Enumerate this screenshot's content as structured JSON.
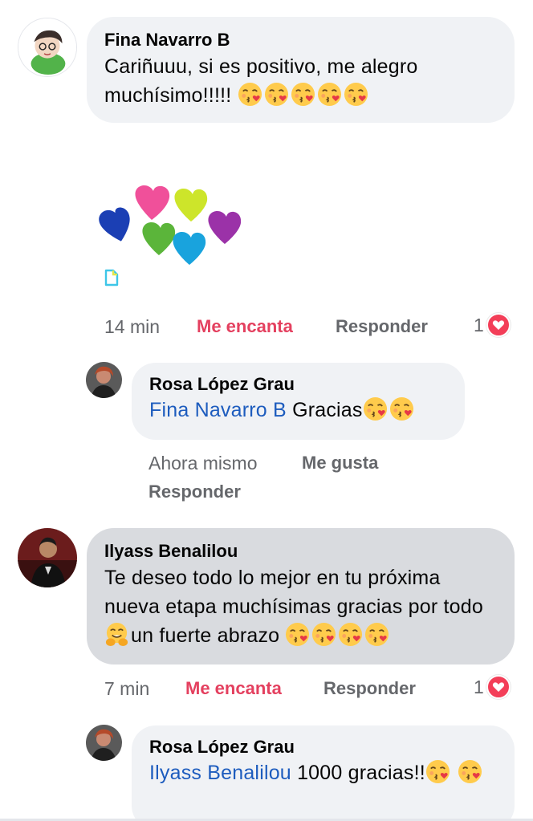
{
  "comments": [
    {
      "author": "Fina Navarro B",
      "text": "Cariñuuu, si es positivo, me alegro muchísimo!!!!!",
      "emoji": "kissing-heart-emoji x5",
      "sticker": "multicolor-hearts-sticker",
      "time": "14 min",
      "reaction_label": "Me encanta",
      "reply_label": "Responder",
      "reaction_count": "1",
      "reaction_icon": "love-heart-icon"
    },
    {
      "author": "Rosa López Grau",
      "mention": "Fina Navarro B",
      "text": "Gracias",
      "emoji": "kissing-heart-emoji x2",
      "time": "Ahora mismo",
      "like_label": "Me gusta",
      "reply_label": "Responder"
    },
    {
      "author": "Ilyass Benalilou",
      "text_part1": "Te deseo todo lo mejor en tu próxima nueva etapa muchísimas gracias por todo",
      "text_part2": "un fuerte abrazo",
      "emoji": "hugging-emoji, kissing-heart-emoji x4",
      "time": "7 min",
      "reaction_label": "Me encanta",
      "reply_label": "Responder",
      "reaction_count": "1",
      "reaction_icon": "love-heart-icon"
    },
    {
      "author": "Rosa López Grau",
      "mention": "Ilyass Benalilou",
      "text": "1000 gracias!!",
      "emoji": "kissing-heart-emoji x2"
    }
  ],
  "colors": {
    "bubble": "#f0f2f5",
    "bubble_selected": "#d9dbdf",
    "love": "#e4405f",
    "mention": "#1d5cbe",
    "secondary_text": "#65676b"
  }
}
